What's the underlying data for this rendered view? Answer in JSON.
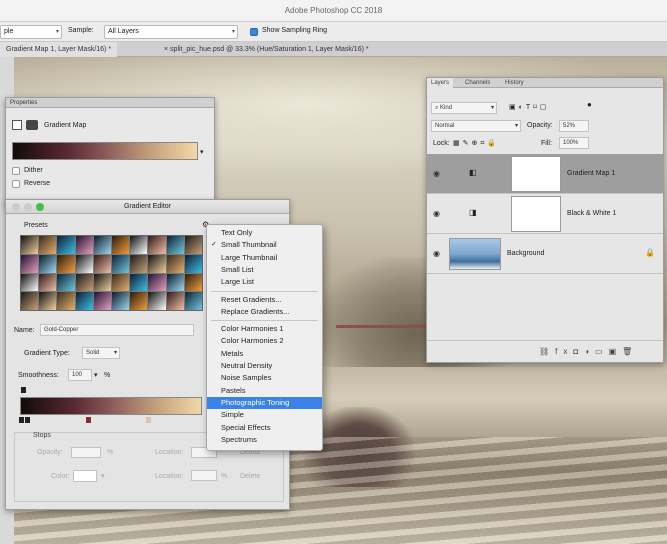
{
  "window": {
    "title": "Adobe Photoshop CC 2018"
  },
  "options": {
    "sample_size": "ple",
    "sample_label": "Sample:",
    "sample_value": "All Layers",
    "show_ring": "Show Sampling Ring"
  },
  "tabs": [
    {
      "label": "Gradient Map 1, Layer Mask/16) *"
    },
    {
      "label": "split_pic_hue.psd @ 33.3% (Hue/Saturation 1, Layer Mask/16) *"
    }
  ],
  "properties": {
    "tab": "Properties",
    "title": "Gradient Map",
    "dither": "Dither",
    "reverse": "Reverse"
  },
  "editor": {
    "title": "Gradient Editor",
    "presets_label": "Presets",
    "name_label": "Name:",
    "name_value": "Gold-Copper",
    "type_label": "Gradient Type:",
    "type_value": "Solid",
    "smooth_label": "Smoothness:",
    "smooth_value": "100",
    "smooth_unit": "%",
    "stops_label": "Stops",
    "opacity_label": "Opacity:",
    "location_label": "Location:",
    "delete_label": "Delete",
    "color_label": "Color:",
    "percent": "%"
  },
  "menu": {
    "items": [
      {
        "label": "Text Only",
        "checked": false
      },
      {
        "label": "Small Thumbnail",
        "checked": true
      },
      {
        "label": "Large Thumbnail",
        "checked": false
      },
      {
        "label": "Small List",
        "checked": false
      },
      {
        "label": "Large List",
        "checked": false
      },
      {
        "label": "Reset Gradients...",
        "checked": false
      },
      {
        "label": "Replace Gradients...",
        "checked": false
      },
      {
        "label": "Color Harmonies 1",
        "checked": false
      },
      {
        "label": "Color Harmonies 2",
        "checked": false
      },
      {
        "label": "Metals",
        "checked": false
      },
      {
        "label": "Neutral Density",
        "checked": false
      },
      {
        "label": "Noise Samples",
        "checked": false
      },
      {
        "label": "Pastels",
        "checked": false
      },
      {
        "label": "Photographic Toning",
        "checked": false,
        "highlighted": true
      },
      {
        "label": "Simple",
        "checked": false
      },
      {
        "label": "Special Effects",
        "checked": false
      },
      {
        "label": "Spectrums",
        "checked": false
      }
    ]
  },
  "layers": {
    "tabs": [
      "Layers",
      "Channels",
      "History"
    ],
    "kind": "Kind",
    "blend": "Normal",
    "opacity_label": "Opacity:",
    "opacity_value": "52%",
    "lock_label": "Lock:",
    "fill_label": "Fill:",
    "fill_value": "100%",
    "items": [
      {
        "name": "Gradient Map 1"
      },
      {
        "name": "Black & White 1"
      },
      {
        "name": "Background"
      }
    ]
  }
}
